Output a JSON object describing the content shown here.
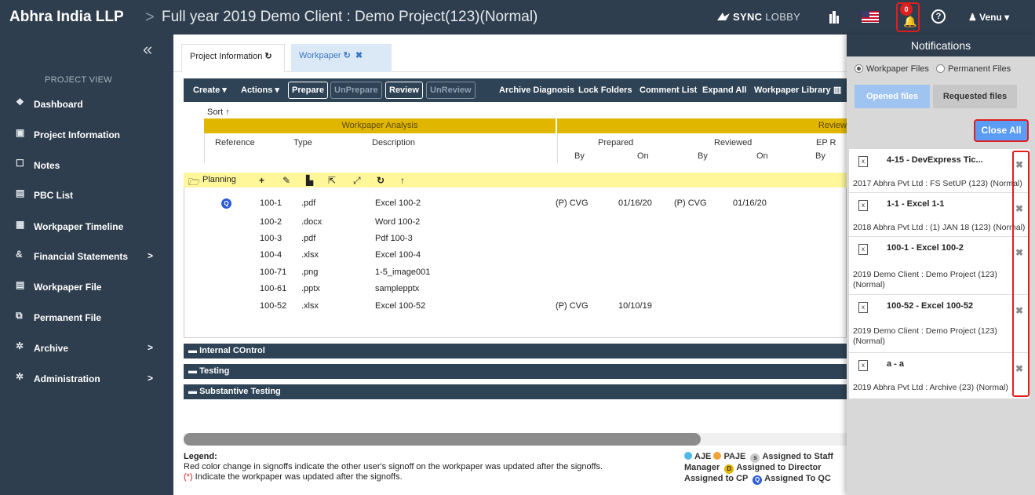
{
  "header": {
    "brand": "Abhra India LLP",
    "separator": ">",
    "crumb": "Full year 2019 Demo Client : Demo Project(123)(Normal)",
    "sync_a": "SYNC",
    "sync_b": "LOBBY",
    "notification_count": "0",
    "help": "?",
    "user": "Venu ▾"
  },
  "sidebar": {
    "collapse": "«",
    "section": "PROJECT VIEW",
    "items": [
      {
        "icon": "home-icon",
        "glyph": "❖",
        "label": "Dashboard"
      },
      {
        "icon": "info-icon",
        "glyph": "▣",
        "label": "Project Information"
      },
      {
        "icon": "notes-icon",
        "glyph": "☐",
        "label": "Notes"
      },
      {
        "icon": "list-icon",
        "glyph": "▤",
        "label": "PBC List"
      },
      {
        "icon": "calendar-icon",
        "glyph": "▦",
        "label": "Workpaper Timeline"
      },
      {
        "icon": "finance-icon",
        "glyph": "&",
        "label": "Financial Statements",
        "arrow": ">"
      },
      {
        "icon": "file-icon",
        "glyph": "▤",
        "label": "Workpaper File"
      },
      {
        "icon": "permanent-file-icon",
        "glyph": "⧉",
        "label": "Permanent File"
      },
      {
        "icon": "archive-icon",
        "glyph": "✲",
        "label": "Archive",
        "arrow": ">"
      },
      {
        "icon": "admin-icon",
        "glyph": "✲",
        "label": "Administration",
        "arrow": ">"
      }
    ]
  },
  "tabs": [
    {
      "label": "Project Information",
      "refresh": "↻"
    },
    {
      "label": "Workpaper",
      "refresh": "↻",
      "close": "✖"
    }
  ],
  "toolbar": {
    "create": "Create ▾",
    "actions": "Actions ▾",
    "prepare": "Prepare",
    "unprepare": "UnPrepare",
    "review": "Review",
    "unreview": "UnReview",
    "archive_diagnosis": "Archive Diagnosis",
    "lock_folders": "Lock Folders",
    "comment_list": "Comment List",
    "expand_all": "Expand All",
    "workpaper_library": "Workpaper Library",
    "columns_glyph": "▥"
  },
  "grid": {
    "sort": "Sort ↑",
    "group1": "Workpaper Analysis",
    "group2": "Review",
    "col_reference": "Reference",
    "col_type": "Type",
    "col_description": "Description",
    "col_prepared": "Prepared",
    "col_reviewed": "Reviewed",
    "col_ep": "EP R",
    "by": "By",
    "on": "On"
  },
  "planning": {
    "label": "Planning",
    "icons": [
      "+",
      "✎",
      "▙",
      "⇱",
      "⤢",
      "↻",
      "↑"
    ]
  },
  "rows": [
    {
      "qc": "Q",
      "ref": "100-1",
      "type": ".pdf",
      "desc": "Excel 100-2",
      "prep_by": "(P) CVG",
      "prep_on": "01/16/20",
      "rev_by": "(P) CVG",
      "rev_on": "01/16/20"
    },
    {
      "qc": "",
      "ref": "100-2",
      "type": ".docx",
      "desc": "Word 100-2",
      "prep_by": "",
      "prep_on": "",
      "rev_by": "",
      "rev_on": ""
    },
    {
      "qc": "",
      "ref": "100-3",
      "type": ".pdf",
      "desc": "Pdf 100-3",
      "prep_by": "",
      "prep_on": "",
      "rev_by": "",
      "rev_on": ""
    },
    {
      "qc": "",
      "ref": "100-4",
      "type": ".xlsx",
      "desc": "Excel 100-4",
      "prep_by": "",
      "prep_on": "",
      "rev_by": "",
      "rev_on": ""
    },
    {
      "qc": "",
      "ref": "100-71",
      "type": ".png",
      "desc": "1-5_image001",
      "prep_by": "",
      "prep_on": "",
      "rev_by": "",
      "rev_on": ""
    },
    {
      "qc": "",
      "ref": "100-61",
      "type": ".pptx",
      "desc": "samplepptx",
      "prep_by": "",
      "prep_on": "",
      "rev_by": "",
      "rev_on": ""
    },
    {
      "qc": "",
      "ref": "100-52",
      "type": ".xlsx",
      "desc": "Excel 100-52",
      "prep_by": "(P) CVG",
      "prep_on": "10/10/19",
      "rev_by": "",
      "rev_on": ""
    }
  ],
  "sections": [
    "Internal COntrol",
    "Testing",
    "Substantive Testing"
  ],
  "legend": {
    "title": "Legend:",
    "line1": "Red color change in signoffs indicate the other user's signoff on the workpaper was updated after the signoffs.",
    "line2_mark": "(*)",
    "line2": " Indicate the workpaper was updated after the signoffs.",
    "aje": "AJE",
    "paje": "PAJE",
    "staff": "Assigned to Staff",
    "manager": "Manager",
    "director": "Assigned to Director",
    "cp": "Assigned to CP",
    "qc": "Assigned To QC",
    "aje_color": "#4fb9e8",
    "paje_color": "#f2a33a"
  },
  "notifications": {
    "title": "Notifications",
    "radio1": "Workpaper Files",
    "radio2": "Permanent Files",
    "tab_opened": "Opened files",
    "tab_requested": "Requested files",
    "close_all": "Close All",
    "items": [
      {
        "title": "4-15 - DevExpress Tic...",
        "desc": "2017 Abhra Pvt Ltd : FS SetUP (123) (Normal)"
      },
      {
        "title": "1-1 - Excel 1-1",
        "desc": "2018 Abhra Pvt Ltd : (1) JAN 18 (123) (Normal)"
      },
      {
        "title": "100-1 - Excel 100-2",
        "desc": "2019 Demo Client : Demo Project (123) (Normal)"
      },
      {
        "title": "100-52 - Excel 100-52",
        "desc": "2019 Demo Client : Demo Project (123) (Normal)"
      },
      {
        "title": "a - a",
        "desc": "2019 Abhra Pvt Ltd : Archive (23) (Normal)"
      }
    ]
  }
}
